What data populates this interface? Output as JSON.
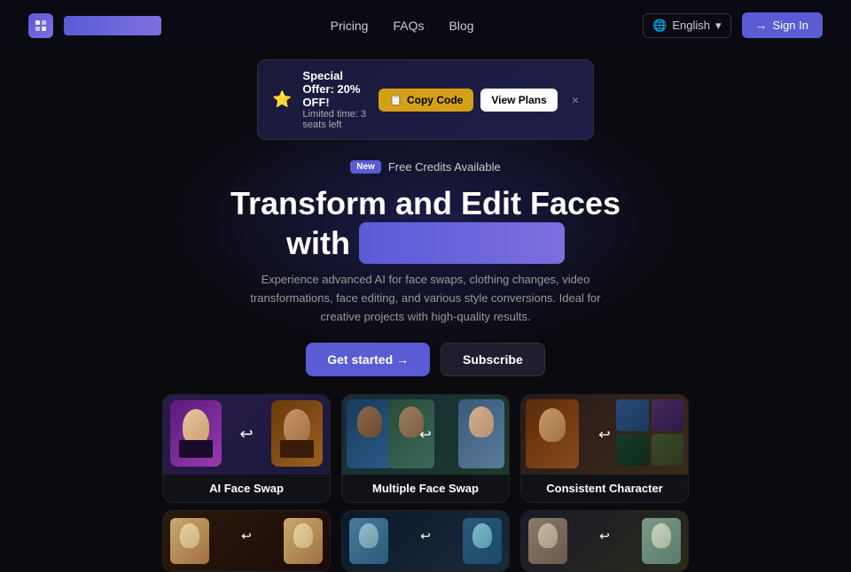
{
  "navbar": {
    "logo_alt": "App Logo",
    "nav_links": [
      "Pricing",
      "FAQs",
      "Blog"
    ],
    "lang": "English",
    "sign_in": "Sign In"
  },
  "banner": {
    "icon": "⭐",
    "title": "Special Offer: 20% OFF!",
    "subtitle": "Limited time: 3 seats left",
    "copy_code": "Copy Code",
    "view_plans": "View Plans",
    "close": "×"
  },
  "hero": {
    "badge_new": "New",
    "badge_text": "Free Credits Available",
    "title_part1": "Transform and Edit Faces",
    "title_part2": "with",
    "title_highlight": "                    ",
    "subtitle": "Experience advanced AI for face swaps, clothing changes, video transformations, face editing, and various style conversions. Ideal for creative projects with high-quality results.",
    "get_started": "Get started →",
    "subscribe": "Subscribe"
  },
  "feature_cards": [
    {
      "id": "ai-face-swap",
      "label": "AI Face Swap",
      "color_left": "#7c3fa0",
      "color_right": "#a07820"
    },
    {
      "id": "multiple-face-swap",
      "label": "Multiple Face Swap",
      "color_left": "#2a4a6a",
      "color_right": "#4a8a9a"
    },
    {
      "id": "consistent-character",
      "label": "Consistent Character",
      "color_left": "#8B4513",
      "color_right": "#2a3a6a"
    }
  ],
  "bottom_cards": [
    {
      "id": "card-b1",
      "color1": "#c9a96e",
      "color2": "#8a7060"
    },
    {
      "id": "card-b2",
      "color1": "#4a7a9a",
      "color2": "#2a5a7a"
    },
    {
      "id": "card-b3",
      "color1": "#9a8a7a",
      "color2": "#7a9a8a"
    }
  ]
}
